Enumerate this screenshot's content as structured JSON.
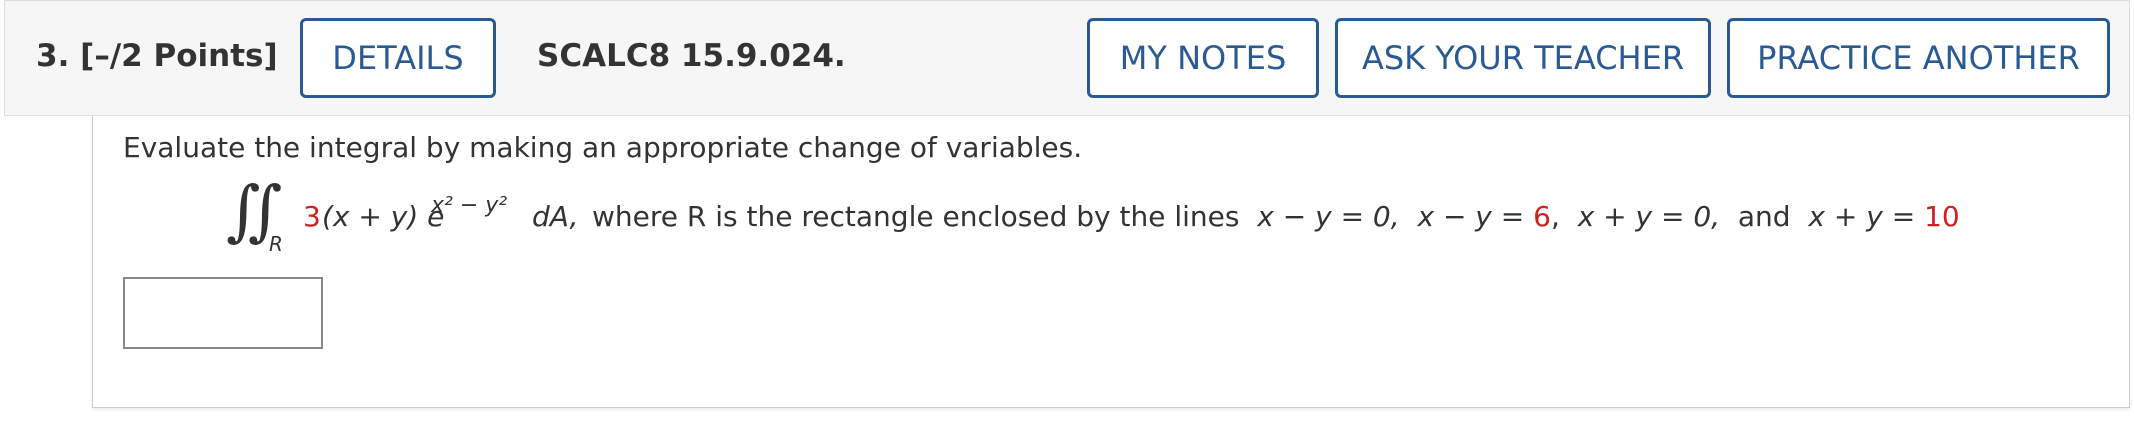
{
  "question": {
    "number_label": "3.",
    "points_label": "[–/2 Points]",
    "problem_id": "SCALC8 15.9.024."
  },
  "buttons": {
    "details": "DETAILS",
    "my_notes": "MY NOTES",
    "ask_teacher": "ASK YOUR TEACHER",
    "practice_another": "PRACTICE ANOTHER"
  },
  "problem": {
    "instruction": "Evaluate the integral by making an appropriate change of variables.",
    "integral_symbol": "∬",
    "region_subscript": "R",
    "coefficient": "3",
    "integrand_base": "(x + y) e",
    "exponent": "x² − y²",
    "differential": "dA,",
    "where_prefix": "where ",
    "region_var": "R",
    "where_mid": " is the rectangle enclosed by the lines  ",
    "line1": "x − y = 0,",
    "line2_lhs": "x − y = ",
    "line2_value": "6",
    "line2_suffix": ",",
    "line3": "x + y = 0,",
    "and_word": "and",
    "line4_lhs": "x + y = ",
    "line4_value": "10"
  },
  "answer": {
    "value": ""
  },
  "colors": {
    "button_border": "#2a5a92",
    "randomized_value": "#cc2222",
    "header_background": "#f6f6f6"
  }
}
